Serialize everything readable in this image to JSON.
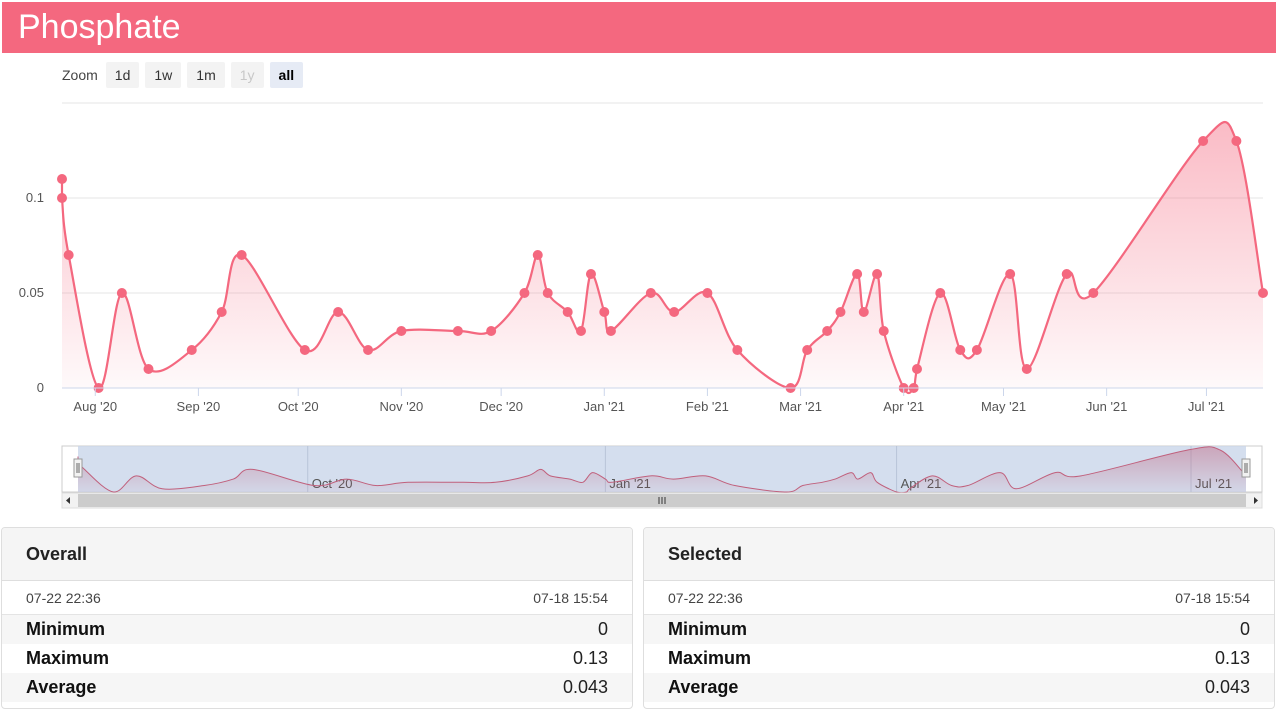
{
  "header": {
    "title": "Phosphate"
  },
  "zoom": {
    "label": "Zoom",
    "buttons": [
      {
        "label": "1d",
        "state": "normal"
      },
      {
        "label": "1w",
        "state": "normal"
      },
      {
        "label": "1m",
        "state": "normal"
      },
      {
        "label": "1y",
        "state": "disabled"
      },
      {
        "label": "all",
        "state": "active"
      }
    ]
  },
  "colors": {
    "series": "#f4687f",
    "header": "#f4687f",
    "navigator_fill": "#c9d6ea"
  },
  "chart_data": {
    "type": "area",
    "title": "",
    "xlabel": "",
    "ylabel": "",
    "xlim": [
      "2020-07-22",
      "2021-07-18"
    ],
    "ylim": [
      0,
      0.15
    ],
    "y_ticks": [
      "0",
      "0.05",
      "0.1"
    ],
    "x_ticks": [
      {
        "label": "Aug '20",
        "date": "2020-08-01"
      },
      {
        "label": "Sep '20",
        "date": "2020-09-01"
      },
      {
        "label": "Oct '20",
        "date": "2020-10-01"
      },
      {
        "label": "Nov '20",
        "date": "2020-11-01"
      },
      {
        "label": "Dec '20",
        "date": "2020-12-01"
      },
      {
        "label": "Jan '21",
        "date": "2021-01-01"
      },
      {
        "label": "Feb '21",
        "date": "2021-02-01"
      },
      {
        "label": "Mar '21",
        "date": "2021-03-01"
      },
      {
        "label": "Apr '21",
        "date": "2021-04-01"
      },
      {
        "label": "May '21",
        "date": "2021-05-01"
      },
      {
        "label": "Jun '21",
        "date": "2021-06-01"
      },
      {
        "label": "Jul '21",
        "date": "2021-07-01"
      }
    ],
    "navigator_ticks": [
      {
        "label": "Oct '20",
        "date": "2020-10-01"
      },
      {
        "label": "Jan '21",
        "date": "2021-01-01"
      },
      {
        "label": "Apr '21",
        "date": "2021-04-01"
      },
      {
        "label": "Jul '21",
        "date": "2021-07-01"
      }
    ],
    "grid": true,
    "legend": "none",
    "series": [
      {
        "points": [
          {
            "x": "2020-07-22",
            "y": 0.11
          },
          {
            "x": "2020-07-22",
            "y": 0.1
          },
          {
            "x": "2020-07-24",
            "y": 0.07
          },
          {
            "x": "2020-08-02",
            "y": 0.0
          },
          {
            "x": "2020-08-09",
            "y": 0.05
          },
          {
            "x": "2020-08-17",
            "y": 0.01
          },
          {
            "x": "2020-08-30",
            "y": 0.02
          },
          {
            "x": "2020-09-08",
            "y": 0.04
          },
          {
            "x": "2020-09-14",
            "y": 0.07
          },
          {
            "x": "2020-10-03",
            "y": 0.02
          },
          {
            "x": "2020-10-13",
            "y": 0.04
          },
          {
            "x": "2020-10-22",
            "y": 0.02
          },
          {
            "x": "2020-11-01",
            "y": 0.03
          },
          {
            "x": "2020-11-18",
            "y": 0.03
          },
          {
            "x": "2020-11-28",
            "y": 0.03
          },
          {
            "x": "2020-12-08",
            "y": 0.05
          },
          {
            "x": "2020-12-12",
            "y": 0.07
          },
          {
            "x": "2020-12-15",
            "y": 0.05
          },
          {
            "x": "2020-12-21",
            "y": 0.04
          },
          {
            "x": "2020-12-25",
            "y": 0.03
          },
          {
            "x": "2020-12-28",
            "y": 0.06
          },
          {
            "x": "2021-01-01",
            "y": 0.04
          },
          {
            "x": "2021-01-03",
            "y": 0.03
          },
          {
            "x": "2021-01-15",
            "y": 0.05
          },
          {
            "x": "2021-01-22",
            "y": 0.04
          },
          {
            "x": "2021-02-01",
            "y": 0.05
          },
          {
            "x": "2021-02-10",
            "y": 0.02
          },
          {
            "x": "2021-02-26",
            "y": 0.0
          },
          {
            "x": "2021-03-03",
            "y": 0.02
          },
          {
            "x": "2021-03-09",
            "y": 0.03
          },
          {
            "x": "2021-03-13",
            "y": 0.04
          },
          {
            "x": "2021-03-18",
            "y": 0.06
          },
          {
            "x": "2021-03-20",
            "y": 0.04
          },
          {
            "x": "2021-03-24",
            "y": 0.06
          },
          {
            "x": "2021-03-26",
            "y": 0.03
          },
          {
            "x": "2021-04-01",
            "y": 0.0
          },
          {
            "x": "2021-04-04",
            "y": 0.0
          },
          {
            "x": "2021-04-05",
            "y": 0.01
          },
          {
            "x": "2021-04-12",
            "y": 0.05
          },
          {
            "x": "2021-04-18",
            "y": 0.02
          },
          {
            "x": "2021-04-23",
            "y": 0.02
          },
          {
            "x": "2021-05-03",
            "y": 0.06
          },
          {
            "x": "2021-05-08",
            "y": 0.01
          },
          {
            "x": "2021-05-20",
            "y": 0.06
          },
          {
            "x": "2021-05-28",
            "y": 0.05
          },
          {
            "x": "2021-06-30",
            "y": 0.13
          },
          {
            "x": "2021-07-10",
            "y": 0.13
          },
          {
            "x": "2021-07-18",
            "y": 0.05
          }
        ]
      }
    ]
  },
  "panels": [
    {
      "title": "Overall",
      "from": "07-22 22:36",
      "to": "07-18 15:54",
      "rows": [
        {
          "label": "Minimum",
          "value": "0"
        },
        {
          "label": "Maximum",
          "value": "0.13"
        },
        {
          "label": "Average",
          "value": "0.043"
        }
      ]
    },
    {
      "title": "Selected",
      "from": "07-22 22:36",
      "to": "07-18 15:54",
      "rows": [
        {
          "label": "Minimum",
          "value": "0"
        },
        {
          "label": "Maximum",
          "value": "0.13"
        },
        {
          "label": "Average",
          "value": "0.043"
        }
      ]
    }
  ]
}
